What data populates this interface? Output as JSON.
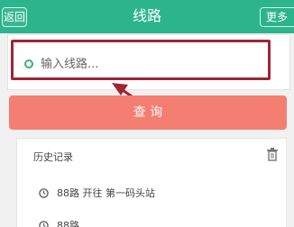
{
  "header": {
    "back_label": "返回",
    "title": "线路",
    "more_label": "更多"
  },
  "search": {
    "placeholder": "输入线路..."
  },
  "query_button": {
    "label": "查 询"
  },
  "history": {
    "title": "历史记录",
    "items": [
      {
        "text": "88路 开往 第一码头站"
      },
      {
        "text": "88路"
      }
    ]
  },
  "colors": {
    "header_bg": "#2cb48c",
    "query_bg": "#f47e72",
    "annotation_red": "#a02434",
    "dot_green": "#3ab46c"
  },
  "icons": [
    "trash-icon",
    "clock-icon",
    "location-dot-icon",
    "annotation-arrow-icon"
  ]
}
